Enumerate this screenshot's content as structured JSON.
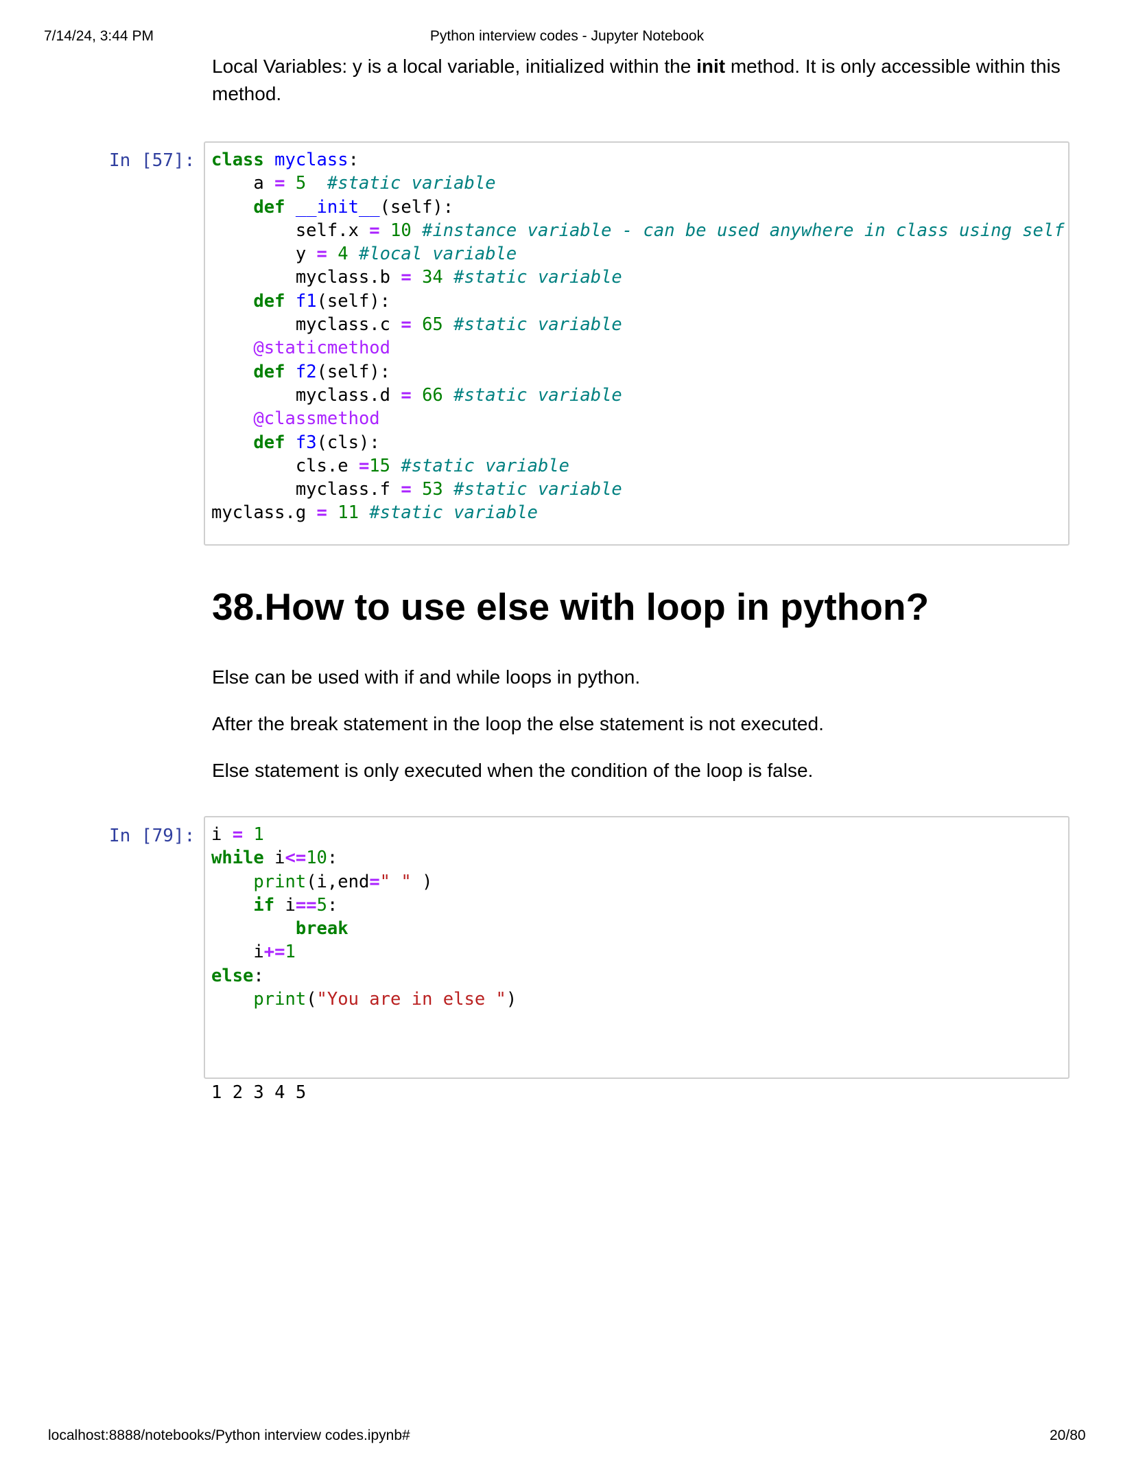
{
  "header": {
    "date": "7/14/24, 3:44 PM",
    "title": "Python interview codes - Jupyter Notebook"
  },
  "footer": {
    "url": "localhost:8888/notebooks/Python interview codes.ipynb#",
    "page": "20/80"
  },
  "intro": {
    "text_before": "Local Variables: y is a local variable, initialized within the ",
    "bold": "init",
    "text_after": " method. It is only accessible within this method."
  },
  "cells": [
    {
      "prompt": "In [57]:",
      "source": [
        "class myclass:",
        "    a = 5  #static variable",
        "    def __init__(self):",
        "        self.x = 10 #instance variable - can be used anywhere in class using self",
        "        y = 4 #local variable",
        "        myclass.b = 34 #static variable",
        "    def f1(self):",
        "        myclass.c = 65 #static variable",
        "    @staticmethod",
        "    def f2(self):",
        "        myclass.d = 66 #static variable",
        "    @classmethod",
        "    def f3(cls):",
        "        cls.e =15 #static variable",
        "        myclass.f = 53 #static variable",
        "myclass.g = 11 #static variable"
      ]
    },
    {
      "prompt": "In [79]:",
      "source": [
        "i = 1",
        "while i<=10:",
        "    print(i,end=\" \" )",
        "    if i==5:",
        "        break",
        "    i+=1",
        "else:",
        "    print(\"You are in else \")"
      ],
      "output": "1 2 3 4 5"
    }
  ],
  "section": {
    "heading": "38.How to use else with loop in python?",
    "paragraphs": [
      "Else can be used with if and while loops in python.",
      "After the break statement in the loop the else statement is not executed.",
      "Else statement is only executed when the condition of the loop is false."
    ]
  }
}
